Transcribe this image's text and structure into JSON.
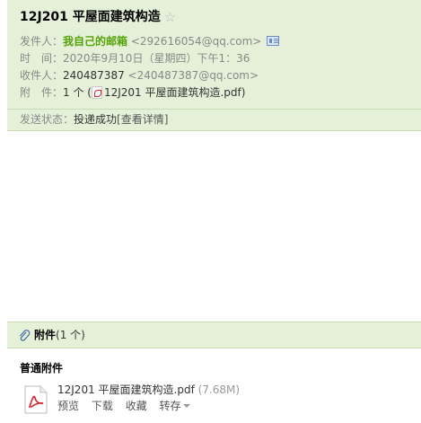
{
  "email": {
    "subject": "12J201 平屋面建筑构造",
    "star_icon": "star-icon",
    "sender_label": "发件人：",
    "sender_name": "我自己的邮箱",
    "sender_addr": "<292616054@qq.com>",
    "time_label": "时　间：",
    "time_value": "2020年9月10日（星期四）下午1：36",
    "recipient_label": "收件人：",
    "recipient_name": "240487387",
    "recipient_addr": "<240487387@qq.com>",
    "attachment_label": "附　件：",
    "attachment_count": "1 个 (",
    "attachment_file": "12J201 平屋面建筑构造.pdf",
    "attachment_close": ")",
    "status_label": "发送状态：",
    "status_value": "投递成功",
    "status_link": "[查看详情]"
  },
  "attachments": {
    "title": "附件",
    "count": "(1 个)",
    "section": "普通附件",
    "file_name": "12J201 平屋面建筑构造.pdf",
    "file_size": "(7.68M)",
    "actions": {
      "preview": "预览",
      "download": "下载",
      "save": "收藏",
      "forward": "转存"
    }
  },
  "colors": {
    "header_bg": "#e4f1d8",
    "sender_green": "#56a20a",
    "pdf_red": "#d6262d"
  }
}
